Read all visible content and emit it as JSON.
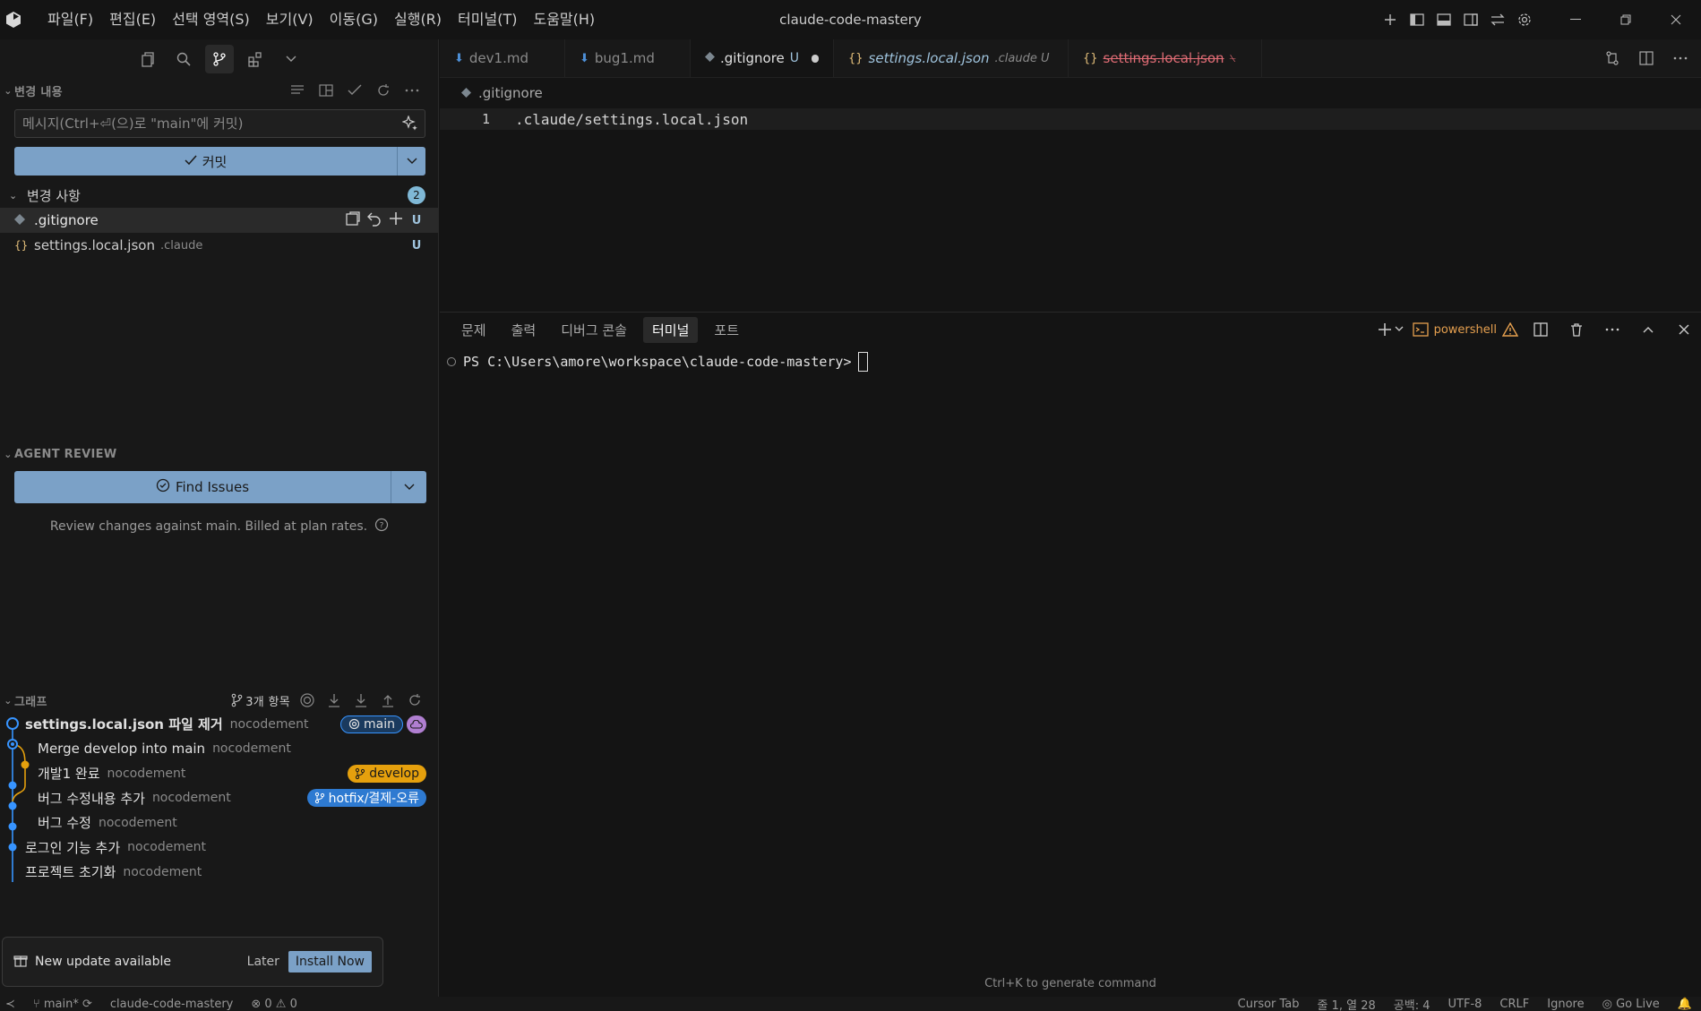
{
  "menubar": {
    "items": [
      "파일(F)",
      "편집(E)",
      "선택 영역(S)",
      "보기(V)",
      "이동(G)",
      "실행(R)",
      "터미널(T)",
      "도움말(H)"
    ]
  },
  "window": {
    "title": "claude-code-mastery"
  },
  "sidebar": {
    "changes_header": "변경 내용",
    "commit_placeholder": "메시지(Ctrl+⏎(으)로 \"main\"에 커밋)",
    "commit_label": "커밋",
    "changes_group": "변경 사항",
    "changes_count": "2",
    "files": [
      {
        "name": ".gitignore",
        "dir": "",
        "status": "U"
      },
      {
        "name": "settings.local.json",
        "dir": ".claude",
        "status": "U"
      }
    ],
    "agent_review_header": "AGENT REVIEW",
    "find_issues_label": "Find Issues",
    "review_note": "Review changes against main. Billed at plan rates.",
    "graph_header": "그래프",
    "graph_count": "3개 항목",
    "commits": [
      {
        "message": "settings.local.json 파일 제거",
        "author": "nocodement",
        "ref": "main"
      },
      {
        "message": "Merge develop into main",
        "author": "nocodement",
        "ref": ""
      },
      {
        "message": "개발1 완료",
        "author": "nocodement",
        "ref": "develop"
      },
      {
        "message": "버그 수정내용 추가",
        "author": "nocodement",
        "ref": "hotfix/결제-오류"
      },
      {
        "message": "버그 수정",
        "author": "nocodement",
        "ref": ""
      },
      {
        "message": "로그인 기능 추가",
        "author": "nocodement",
        "ref": ""
      },
      {
        "message": "프로젝트 초기화",
        "author": "nocodement",
        "ref": ""
      }
    ]
  },
  "notification": {
    "message": "New update available",
    "later": "Later",
    "install": "Install Now"
  },
  "editor": {
    "tabs": [
      {
        "label": "dev1.md",
        "suffix": "",
        "icon": "markdown-icon"
      },
      {
        "label": "bug1.md",
        "suffix": "",
        "icon": "markdown-icon"
      },
      {
        "label": ".gitignore",
        "suffix": "U",
        "icon": "gitignore-icon"
      },
      {
        "label": "settings.local.json",
        "suffix": ".claude U",
        "icon": "json-icon"
      },
      {
        "label": "settings.local.json",
        "suffix": "",
        "icon": "json-icon"
      }
    ],
    "breadcrumb": ".gitignore",
    "line_number": "1",
    "line_text": ".claude/settings.local.json"
  },
  "panel": {
    "tabs": [
      "문제",
      "출력",
      "디버그 콘솔",
      "터미널",
      "포트"
    ],
    "terminal_name": "powershell",
    "prompt": "PS C:\\Users\\amore\\workspace\\claude-code-mastery>",
    "hint": "Ctrl+K to generate command"
  },
  "statusbar": {
    "branch": "main*",
    "project": "claude-code-mastery",
    "problems": "⊗ 0 ⚠ 0",
    "cursor_tab": "Cursor Tab",
    "position": "줄 1, 열 28",
    "spaces": "공백: 4",
    "encoding": "UTF-8",
    "eol": "CRLF",
    "language": "Ignore",
    "golive": "Go Live"
  },
  "colors": {
    "accent_button": "#7ba1c7",
    "main_badge": "#2e7ad1",
    "develop_badge": "#e5a00d",
    "hotfix_badge": "#2e7ad1",
    "cloud_badge": "#b07fd1",
    "terminal_warning": "#e6a04f"
  }
}
